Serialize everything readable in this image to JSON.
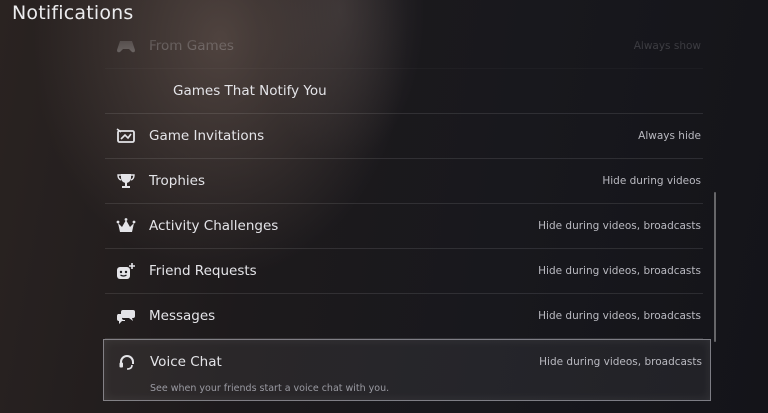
{
  "page": {
    "title": "Notifications"
  },
  "rows": [
    {
      "label": "From Games",
      "value": "Always show",
      "icon": "gamepad-icon"
    },
    {
      "label": "Games That Notify You",
      "value": "",
      "icon": ""
    },
    {
      "label": "Game Invitations",
      "value": "Always hide",
      "icon": "game-invitation-icon"
    },
    {
      "label": "Trophies",
      "value": "Hide during videos",
      "icon": "trophy-icon"
    },
    {
      "label": "Activity Challenges",
      "value": "Hide during videos, broadcasts",
      "icon": "crown-icon"
    },
    {
      "label": "Friend Requests",
      "value": "Hide during videos, broadcasts",
      "icon": "friend-request-icon"
    },
    {
      "label": "Messages",
      "value": "Hide during videos, broadcasts",
      "icon": "messages-icon"
    }
  ],
  "selected_row": {
    "label": "Voice Chat",
    "value": "Hide during videos, broadcasts",
    "description": "See when your friends start a voice chat with you.",
    "icon": "headset-icon"
  }
}
